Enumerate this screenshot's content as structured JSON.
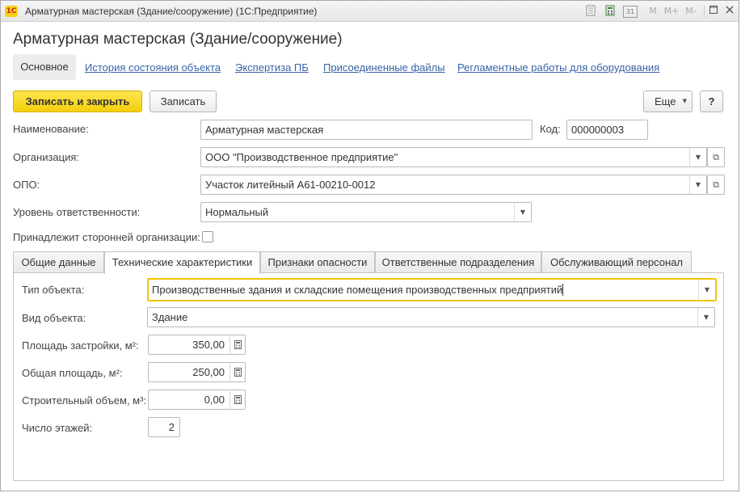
{
  "window": {
    "title": "Арматурная мастерская (Здание/сооружение)  (1С:Предприятие)",
    "logo": "1С",
    "controls": [
      "doc-icon",
      "calendar-icon",
      "31",
      "M",
      "M+",
      "M-",
      "minimize-icon",
      "restore-icon",
      "close-icon"
    ],
    "m_label": "M",
    "mplus_label": "M+",
    "mminus_label": "M-",
    "cal_label": "31"
  },
  "form": {
    "title": "Арматурная мастерская (Здание/сооружение)"
  },
  "nav": {
    "active": "Основное",
    "links": [
      "История состояния объекта",
      "Экспертиза ПБ",
      "Присоединенные файлы",
      "Регламентные работы для оборудования"
    ]
  },
  "toolbar": {
    "save_close": "Записать и закрыть",
    "save": "Записать",
    "more": "Еще",
    "help": "?"
  },
  "fields": {
    "name_label": "Наименование:",
    "name_value": "Арматурная мастерская",
    "code_label": "Код:",
    "code_value": "000000003",
    "org_label": "Организация:",
    "org_value": "ООО \"Производственное предприятие\"",
    "opo_label": "ОПО:",
    "opo_value": "Участок литейный А61-00210-0012",
    "resp_label": "Уровень ответственности:",
    "resp_value": "Нормальный",
    "third_party_label": "Принадлежит сторонней организации:",
    "third_party_checked": false
  },
  "tabs": [
    "Общие данные",
    "Технические характеристики",
    "Признаки опасности",
    "Ответственные подразделения",
    "Обслуживающий персонал"
  ],
  "active_tab": "Технические характеристики",
  "tech": {
    "type_label": "Тип объекта:",
    "type_value": "Производственные здания и складские помещения производственных предприятий",
    "kind_label": "Вид объекта:",
    "kind_value": "Здание",
    "build_area_label": "Площадь застройки, м²:",
    "build_area_value": "350,00",
    "total_area_label": "Общая площадь, м²:",
    "total_area_value": "250,00",
    "volume_label": "Строительный объем, м³:",
    "volume_value": "0,00",
    "floors_label": "Число этажей:",
    "floors_value": "2"
  },
  "colors": {
    "primary_button": "#f4cf0b",
    "link": "#3a63a7",
    "focus_border": "#f2c500"
  }
}
